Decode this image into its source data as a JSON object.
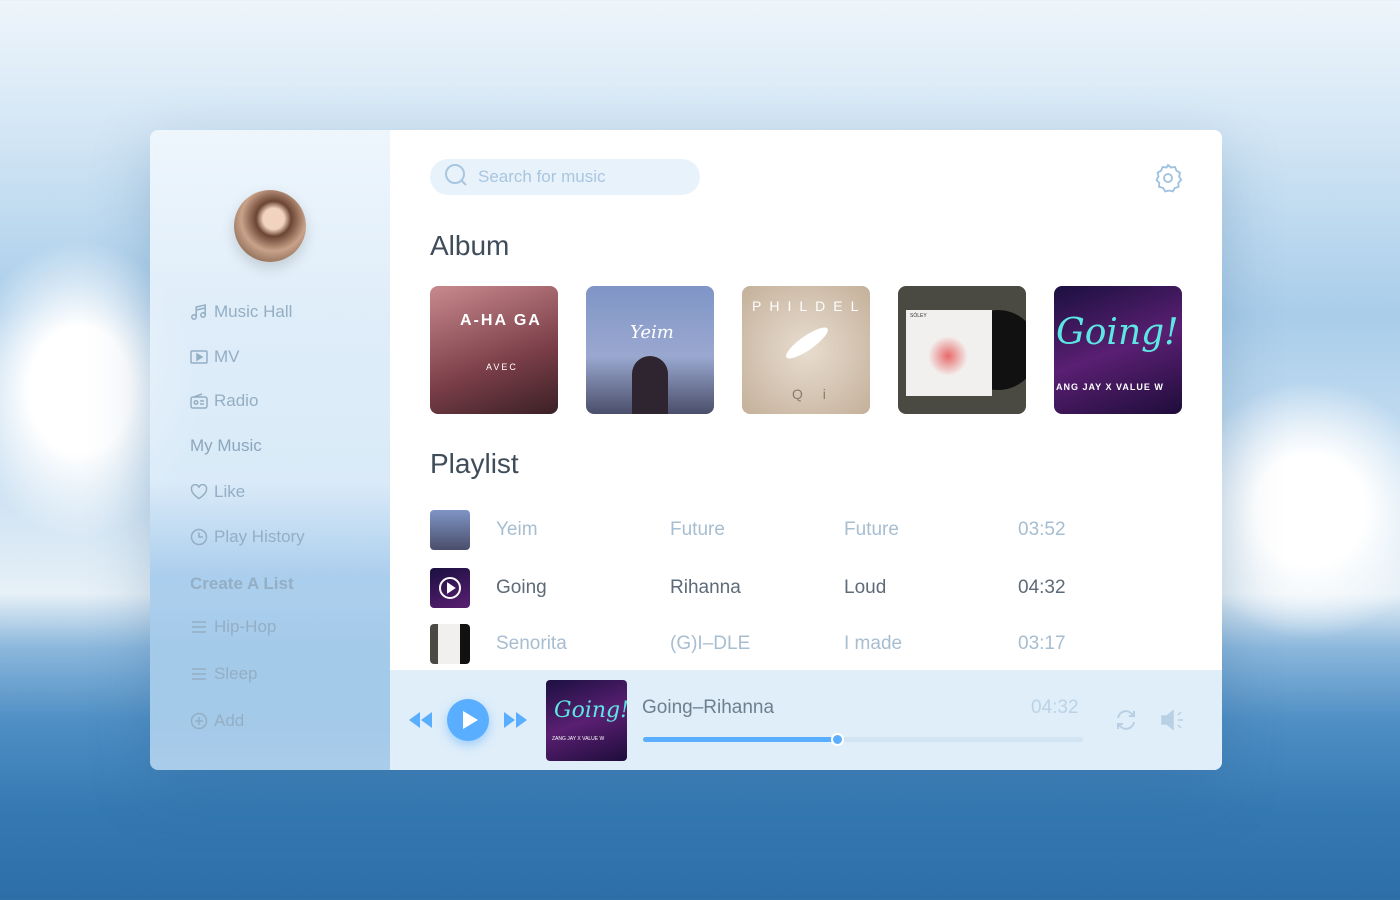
{
  "search": {
    "placeholder": "Search for music"
  },
  "sidebar": {
    "items": [
      {
        "label": "Music Hall",
        "icon": "music-note-icon"
      },
      {
        "label": "MV",
        "icon": "video-icon"
      },
      {
        "label": "Radio",
        "icon": "radio-icon"
      },
      {
        "label": "My Music",
        "icon": ""
      },
      {
        "label": "Like",
        "icon": "heart-icon"
      },
      {
        "label": "Play History",
        "icon": "clock-icon"
      },
      {
        "label": "Create A List",
        "icon": ""
      },
      {
        "label": "Hip-Hop",
        "icon": "list-icon"
      },
      {
        "label": "Sleep",
        "icon": "list-icon"
      },
      {
        "label": "Add",
        "icon": "plus-circle-icon"
      }
    ]
  },
  "album": {
    "title": "Album",
    "covers": [
      {
        "text": "A-HA GA",
        "sub": "AVEC"
      },
      {
        "text": "Yeim"
      },
      {
        "text": "PHILDEL",
        "sub": "Q i"
      },
      {
        "text": "SÓLEY"
      },
      {
        "text": "Going!",
        "sub": "ANG JAY X VALUE W"
      }
    ]
  },
  "playlist": {
    "title": "Playlist",
    "rows": [
      {
        "song": "Yeim",
        "artist": "Future",
        "album": "Future",
        "duration": "03:52"
      },
      {
        "song": "Going",
        "artist": "Rihanna",
        "album": "Loud",
        "duration": "04:32",
        "active": true
      },
      {
        "song": "Senorita",
        "artist": "(G)I–DLE",
        "album": "I made",
        "duration": "03:17"
      }
    ]
  },
  "player": {
    "title": "Going–Rihanna",
    "duration": "04:32",
    "progress_percent": 44,
    "cover_text": "Going!",
    "cover_sub": "ZANG JAY X VALUE W",
    "accent": "#5aaeff"
  }
}
